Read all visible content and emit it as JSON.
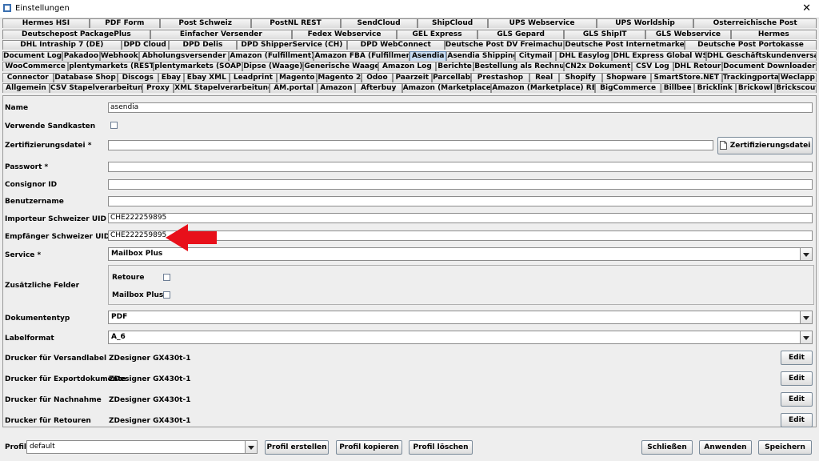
{
  "window": {
    "title": "Einstellungen",
    "close_glyph": "✕"
  },
  "tab_rows": [
    [
      "Hermes HSI",
      "PDF Form",
      "Post Schweiz",
      "PostNL REST",
      "SendCloud",
      "ShipCloud",
      "UPS Webservice",
      "UPS Worldship",
      "Österreichische Post"
    ],
    [
      "Deutschepost PackagePlus",
      "Einfacher Versender",
      "Fedex Webservice",
      "GEL Express",
      "GLS Gepard",
      "GLS ShipIT",
      "GLS Webservice",
      "Hermes"
    ],
    [
      "DHL Intraship 7 (DE)",
      "DPD Cloud",
      "DPD Delis",
      "DPD ShipperService (CH)",
      "DPD WebConnect",
      "Deutsche Post DV Freimachung",
      "Deutsche Post Internetmarke",
      "Deutsche Post Portokasse"
    ],
    [
      "Document Log",
      "Pakadoo",
      "Webhook",
      "Abholungsversender",
      "Amazon (Fulfillment)",
      "Amazon FBA (Fulfillment)",
      "Asendia",
      "Asendia Shipping",
      "Citymail",
      "DHL Easylog",
      "DHL Express Global WS",
      "DHL Geschäftskundenversand"
    ],
    [
      "WooCommerce",
      "plentymarkets (REST)",
      "plentymarkets (SOAP)",
      "Dipse (Waage)",
      "Generische Waage",
      "Amazon Log",
      "Berichte",
      "Bestellung als Rechnung",
      "CN2x Dokument",
      "CSV Log",
      "DHL Retoure",
      "Document Downloader"
    ],
    [
      "Connector",
      "Database Shop",
      "Discogs",
      "Ebay",
      "Ebay XML",
      "Leadprint",
      "Magento",
      "Magento 2",
      "Odoo",
      "Paarzeit",
      "Parcellab",
      "Prestashop",
      "Real",
      "Shopify",
      "Shopware",
      "SmartStore.NET",
      "Trackingportal",
      "Weclapp"
    ],
    [
      "Allgemein",
      "CSV Stapelverarbeitung",
      "Proxy",
      "XML Stapelverarbeitung",
      "AM.portal",
      "Amazon",
      "Afterbuy",
      "Amazon (Marketplace)",
      "Amazon (Marketplace) REST",
      "BigCommerce",
      "Billbee",
      "Bricklink",
      "Brickowl",
      "Brickscout"
    ]
  ],
  "active_tab": "Asendia",
  "form": {
    "name_label": "Name",
    "name_value": "asendia",
    "sandbox_label": "Verwende Sandkasten",
    "cert_label": "Zertifizierungsdatei *",
    "cert_value": "",
    "cert_button": "Zertifizierungsdatei",
    "password_label": "Passwort *",
    "password_value": "",
    "consignor_label": "Consignor ID",
    "consignor_value": "",
    "user_label": "Benutzername",
    "user_value": "",
    "importer_label": "Importeur Schweizer UID *",
    "importer_value": "CHE222259895",
    "receiver_label": "Empfänger Schweizer UID *",
    "receiver_value": "CHE222259895",
    "service_label": "Service *",
    "service_value": "Mailbox Plus",
    "extra_label": "Zusätzliche Felder",
    "retoure_label": "Retoure",
    "mailbox_label": "Mailbox Plus",
    "doctype_label": "Dokumententyp",
    "doctype_value": "PDF",
    "labelformat_label": "Labelformat",
    "labelformat_value": "A_6",
    "printers": [
      {
        "label": "Drucker für Versandlabel",
        "value": "ZDesigner GX430t-1"
      },
      {
        "label": "Drucker für Exportdokumente",
        "value": "ZDesigner GX430t-1"
      },
      {
        "label": "Drucker für Nachnahme",
        "value": "ZDesigner GX430t-1"
      },
      {
        "label": "Drucker für Retouren",
        "value": "ZDesigner GX430t-1"
      }
    ],
    "edit_label": "Edit"
  },
  "bottom": {
    "profile_label": "Profil",
    "profile_value": "default",
    "create": "Profil erstellen",
    "copy": "Profil kopieren",
    "delete": "Profil löschen",
    "close": "Schließen",
    "apply": "Anwenden",
    "save": "Speichern"
  },
  "colors": {
    "accent_arrow": "#e8101a",
    "active_tab": "#c9dcf0"
  }
}
